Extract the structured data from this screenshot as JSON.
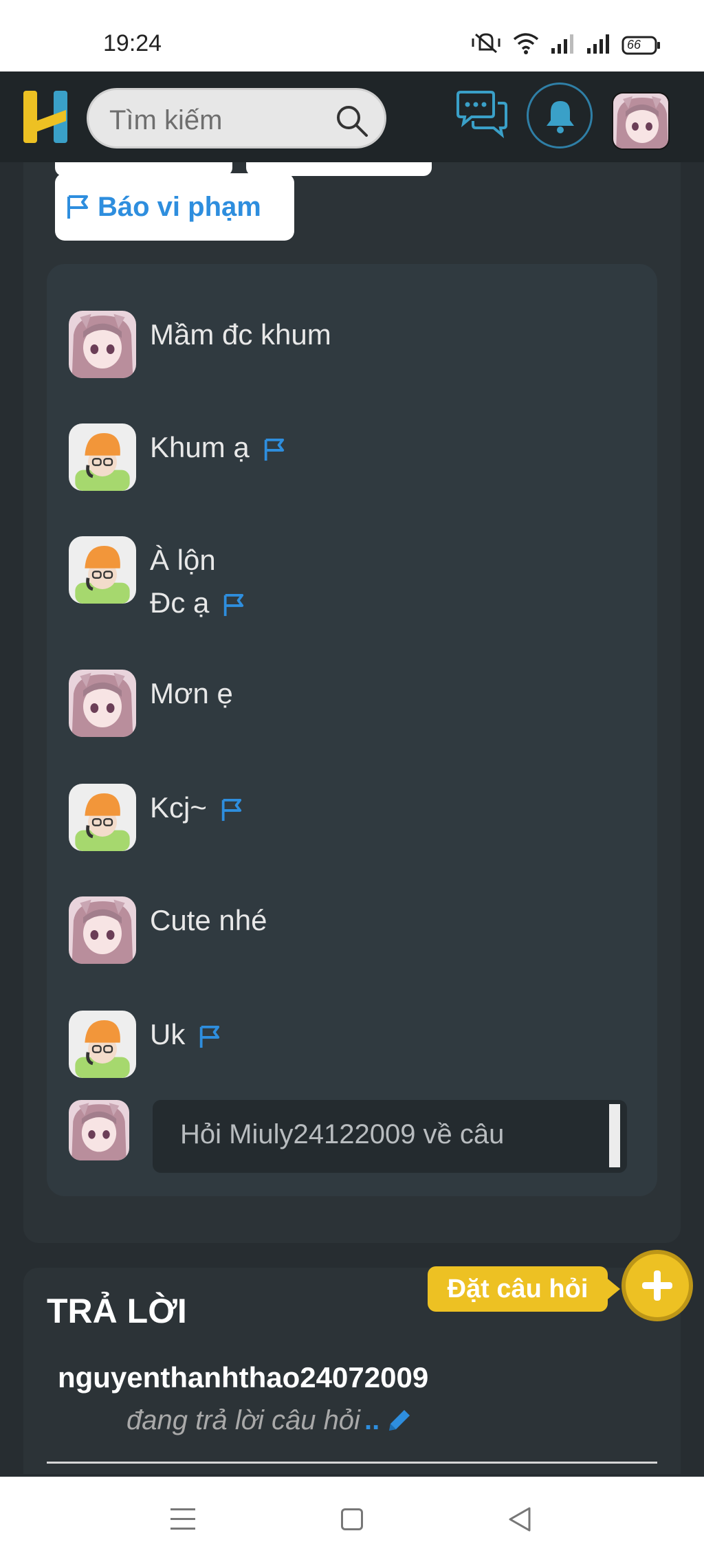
{
  "status_bar": {
    "time": "19:24",
    "battery": "66",
    "icons": [
      "mute-icon",
      "wifi-icon",
      "signal-icon",
      "signal-icon",
      "battery-icon"
    ]
  },
  "header": {
    "logo": "H",
    "search_placeholder": "Tìm kiếm",
    "icons": [
      "search-icon",
      "chat-icon",
      "bell-icon",
      "avatar"
    ]
  },
  "question": {
    "report_label": "Báo vi phạm",
    "comments": [
      {
        "avatar": "anime-girl",
        "lines": [
          "Mầm đc khum"
        ],
        "flag": false
      },
      {
        "avatar": "orange-hat",
        "lines": [
          "Khum ạ"
        ],
        "flag": true
      },
      {
        "avatar": "orange-hat",
        "lines": [
          "À lộn",
          "Đc ạ"
        ],
        "flag": true
      },
      {
        "avatar": "anime-girl",
        "lines": [
          "Mơn ẹ"
        ],
        "flag": false
      },
      {
        "avatar": "orange-hat",
        "lines": [
          "Kcj~"
        ],
        "flag": true
      },
      {
        "avatar": "anime-girl",
        "lines": [
          "Cute nhé"
        ],
        "flag": false
      },
      {
        "avatar": "orange-hat",
        "lines": [
          "Uk"
        ],
        "flag": true
      }
    ],
    "ask_placeholder": "Hỏi Miuly24122009 về câu"
  },
  "answer": {
    "title": "TRẢ LỜI",
    "username": "nguyenthanhthao24072009",
    "status": "đang trả lời câu hỏi",
    "status_dots": ".."
  },
  "fab": {
    "label": "Đặt câu hỏi",
    "icon": "plus-icon"
  },
  "nav": {
    "icons": [
      "menu-icon",
      "home-icon",
      "back-icon"
    ]
  },
  "colors": {
    "accent_blue": "#2e8ede",
    "accent_yellow": "#edc123",
    "background": "#272d31"
  }
}
